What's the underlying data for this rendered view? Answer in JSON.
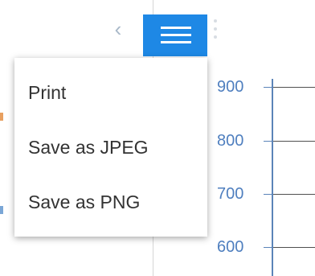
{
  "toolbar": {
    "back_icon": "chevron-left-icon",
    "menu_icon": "hamburger-menu-icon",
    "more_icon": "vertical-dots-icon",
    "menu_color": "#1e88e5"
  },
  "chart_axis": {
    "ticks": [
      "900",
      "800",
      "700",
      "600"
    ],
    "tick_color": "#4f7fbf"
  },
  "export_menu": {
    "items": [
      {
        "label": "Print"
      },
      {
        "label": "Save as JPEG"
      },
      {
        "label": "Save as PNG"
      }
    ]
  }
}
